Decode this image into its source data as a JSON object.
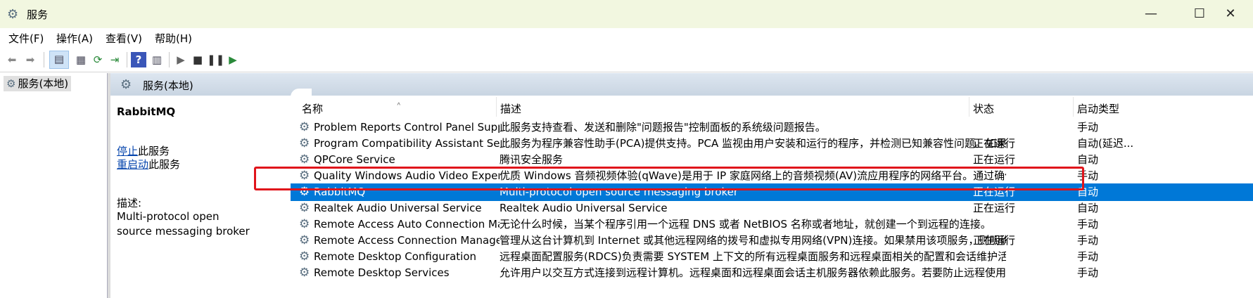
{
  "window": {
    "title": "服务",
    "minimize": "—",
    "maximize": "☐",
    "close": "✕"
  },
  "menu": [
    "文件(F)",
    "操作(A)",
    "查看(V)",
    "帮助(H)"
  ],
  "tree": {
    "root_label": "服务(本地)"
  },
  "main": {
    "header_title": "服务(本地)",
    "extended": {
      "service_name": "RabbitMQ",
      "stop_link": "停止",
      "stop_suffix": "此服务",
      "restart_link": "重启动",
      "restart_suffix": "此服务",
      "desc_label": "描述:",
      "desc_text": "Multi-protocol open source messaging broker"
    },
    "columns": {
      "name": "名称",
      "desc": "描述",
      "status": "状态",
      "startup": "启动类型"
    },
    "rows": [
      {
        "name": "Problem Reports Control Panel Support",
        "desc": "此服务支持查看、发送和删除\"问题报告\"控制面板的系统级问题报告。",
        "status": "",
        "startup": "手动"
      },
      {
        "name": "Program Compatibility Assistant Service",
        "desc": "此服务为程序兼容性助手(PCA)提供支持。PCA 监视由用户安装和运行的程序，并检测已知兼容性问题。如果停...",
        "status": "正在运行",
        "startup": "自动(延迟..."
      },
      {
        "name": "QPCore Service",
        "desc": "腾讯安全服务",
        "status": "正在运行",
        "startup": "自动"
      },
      {
        "name": "Quality Windows Audio Video Experience",
        "desc": "优质 Windows 音频视频体验(qWave)是用于 IP 家庭网络上的音频视频(AV)流应用程序的网络平台。通过确保 A...",
        "status": "",
        "startup": "手动"
      },
      {
        "name": "RabbitMQ",
        "desc": "Multi-protocol open source messaging broker",
        "status": "正在运行",
        "startup": "自动",
        "selected": true
      },
      {
        "name": "Realtek Audio Universal Service",
        "desc": "Realtek Audio Universal Service",
        "status": "正在运行",
        "startup": "自动"
      },
      {
        "name": "Remote Access Auto Connection Manager",
        "desc": "无论什么时候，当某个程序引用一个远程 DNS 或者 NetBIOS 名称或者地址，就创建一个到远程的连接。",
        "status": "",
        "startup": "手动"
      },
      {
        "name": "Remote Access Connection Manager",
        "desc": "管理从这台计算机到 Internet 或其他远程网络的拨号和虚拟专用网络(VPN)连接。如果禁用该项服务，则明确依...",
        "status": "正在运行",
        "startup": "手动"
      },
      {
        "name": "Remote Desktop Configuration",
        "desc": "远程桌面配置服务(RDCS)负责需要 SYSTEM 上下文的所有远程桌面服务和远程桌面相关的配置和会话维护活动...",
        "status": "",
        "startup": "手动"
      },
      {
        "name": "Remote Desktop Services",
        "desc": "允许用户以交互方式连接到远程计算机。远程桌面和远程桌面会话主机服务器依赖此服务。若要防止远程使用此...",
        "status": "",
        "startup": "手动"
      }
    ]
  },
  "colors": {
    "selection": "#0078d7",
    "highlight_box": "#e0141b",
    "title_bar": "#f2f7e0"
  },
  "icons": [
    "gear-icon",
    "back-arrow-icon",
    "forward-arrow-icon",
    "console-tree-icon",
    "properties-icon",
    "refresh-icon",
    "export-icon",
    "help-icon",
    "view-icon",
    "play-icon",
    "stop-icon",
    "pause-icon",
    "resume-icon"
  ]
}
